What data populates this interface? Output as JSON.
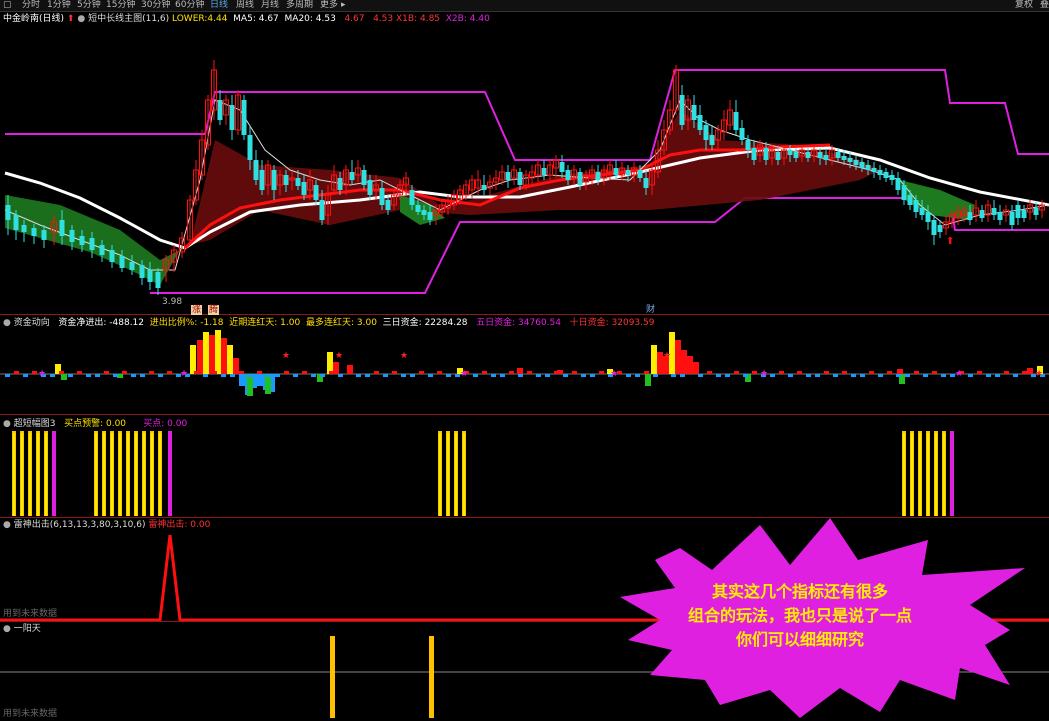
{
  "toolbar": {
    "tabs": [
      "分时",
      "1分钟",
      "5分钟",
      "15分钟",
      "30分钟",
      "60分钟",
      "日线",
      "周线",
      "月线",
      "多周期",
      "更多"
    ],
    "active_index": 6,
    "right_buttons": [
      "复权",
      "叠"
    ]
  },
  "main_panel": {
    "stock_name": "中金岭南",
    "period": "(日线)",
    "indicator_name": "短中长线主图(11,6)",
    "lower_label": "LOWER:",
    "lower_value": "4.44",
    "ma5_label": "MA5:",
    "ma5_value": "4.67",
    "ma20_label": "MA20:",
    "ma20_value": "4.53",
    "v1": "4.67",
    "v2": "4.53",
    "x1b_label": "X1B:",
    "x1b_value": "4.85",
    "x2b_label": "X2B:",
    "x2b_value": "4.40",
    "low_price_label": "3.98",
    "marker_1": "涨",
    "marker_2": "腾",
    "marker_3": "财"
  },
  "fund_panel": {
    "title": "资金动向",
    "net_label": "资金净进出:",
    "net_value": "-488.12",
    "ratio_label": "进出比例%:",
    "ratio_value": "-1.18",
    "recent_label": "近期连红天:",
    "recent_value": "1.00",
    "most_label": "最多连红天:",
    "most_value": "3.00",
    "three_label": "三日资金:",
    "three_value": "22284.28",
    "five_label": "五日资金:",
    "five_value": "34760.54",
    "ten_label": "十日资金:",
    "ten_value": "32093.59"
  },
  "oversold_panel": {
    "title": "超短幅图3",
    "buy_alert_label": "买点预警:",
    "buy_alert_value": "0.00",
    "buy_label": "买点:",
    "buy_value": "0.00"
  },
  "thunder_panel": {
    "title": "雷神出击(6,13,13,3,80,3,10,6)",
    "sub_label": "雷神出击:",
    "sub_value": "0.00",
    "future_note": "用到未来数据"
  },
  "yang_panel": {
    "title": "一阳天",
    "future_note": "用到未来数据"
  },
  "callout": {
    "line1": "其实这几个指标还有很多",
    "line2": "组合的玩法，我也只是说了一点",
    "line3": "你们可以细细研究"
  },
  "colors": {
    "magenta": "#e020e0",
    "white_line": "#ffffff",
    "red": "#ff1010",
    "cyan": "#30e0e0",
    "yellow": "#ffee00",
    "green_fill": "#1e7a1e",
    "darkred_fill": "#6a0c0c"
  }
}
